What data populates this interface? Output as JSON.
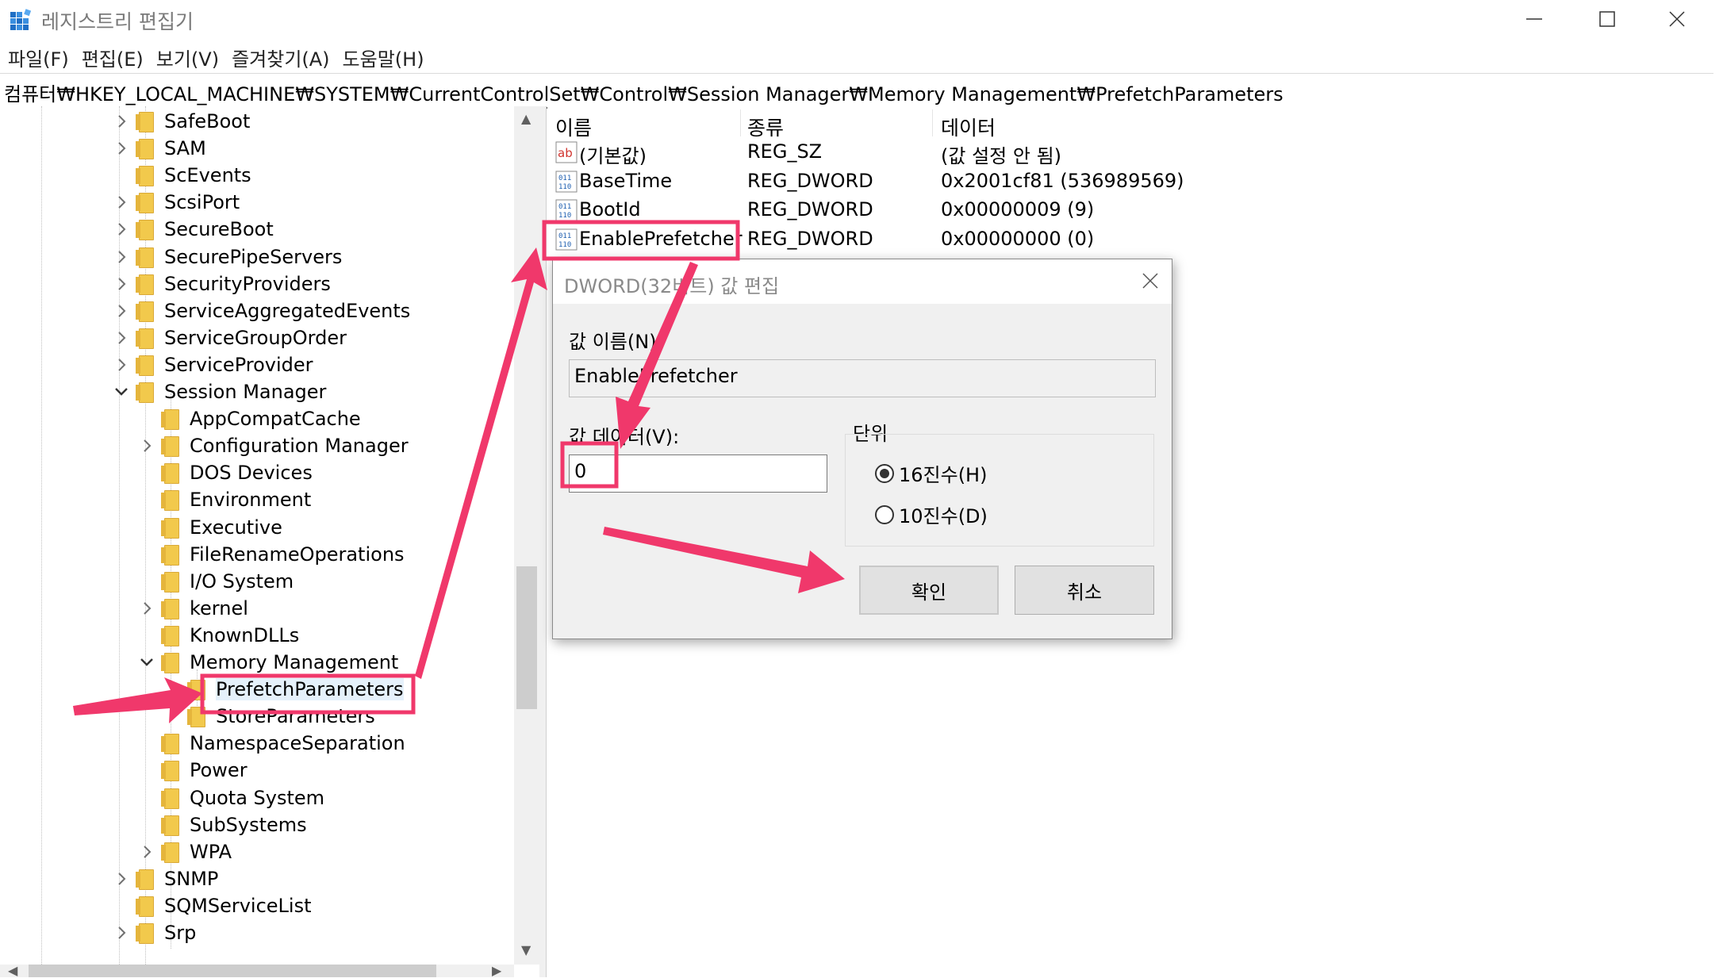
{
  "window": {
    "title": "레지스트리 편집기"
  },
  "menu": [
    "파일(F)",
    "편집(E)",
    "보기(V)",
    "즐겨찾기(A)",
    "도움말(H)"
  ],
  "address": "컴퓨터₩HKEY_LOCAL_MACHINE₩SYSTEM₩CurrentControlSet₩Control₩Session Manager₩Memory Management₩PrefetchParameters",
  "tree": [
    {
      "label": "SafeBoot",
      "expander": "right"
    },
    {
      "label": "SAM",
      "expander": "right"
    },
    {
      "label": "ScEvents",
      "expander": "none"
    },
    {
      "label": "ScsiPort",
      "expander": "right"
    },
    {
      "label": "SecureBoot",
      "expander": "right"
    },
    {
      "label": "SecurePipeServers",
      "expander": "right"
    },
    {
      "label": "SecurityProviders",
      "expander": "right"
    },
    {
      "label": "ServiceAggregatedEvents",
      "expander": "right"
    },
    {
      "label": "ServiceGroupOrder",
      "expander": "right"
    },
    {
      "label": "ServiceProvider",
      "expander": "right"
    },
    {
      "label": "Session Manager",
      "expander": "down"
    },
    {
      "label": "AppCompatCache",
      "expander": "none"
    },
    {
      "label": "Configuration Manager",
      "expander": "right"
    },
    {
      "label": "DOS Devices",
      "expander": "none"
    },
    {
      "label": "Environment",
      "expander": "none"
    },
    {
      "label": "Executive",
      "expander": "none"
    },
    {
      "label": "FileRenameOperations",
      "expander": "none"
    },
    {
      "label": "I/O System",
      "expander": "none"
    },
    {
      "label": "kernel",
      "expander": "right"
    },
    {
      "label": "KnownDLLs",
      "expander": "none"
    },
    {
      "label": "Memory Management",
      "expander": "down"
    },
    {
      "label": "PrefetchParameters",
      "expander": "none"
    },
    {
      "label": "StoreParameters",
      "expander": "none"
    },
    {
      "label": "NamespaceSeparation",
      "expander": "none"
    },
    {
      "label": "Power",
      "expander": "none"
    },
    {
      "label": "Quota System",
      "expander": "none"
    },
    {
      "label": "SubSystems",
      "expander": "none"
    },
    {
      "label": "WPA",
      "expander": "right"
    },
    {
      "label": "SNMP",
      "expander": "right"
    },
    {
      "label": "SQMServiceList",
      "expander": "none"
    },
    {
      "label": "Srp",
      "expander": "right"
    }
  ],
  "list": {
    "headers": {
      "name": "이름",
      "type": "종류",
      "data": "데이터"
    },
    "rows": [
      {
        "icon": "string-value-icon",
        "name": "(기본값)",
        "type": "REG_SZ",
        "data": "(값 설정 안 됨)"
      },
      {
        "icon": "binary-value-icon",
        "name": "BaseTime",
        "type": "REG_DWORD",
        "data": "0x2001cf81 (536989569)"
      },
      {
        "icon": "binary-value-icon",
        "name": "BootId",
        "type": "REG_DWORD",
        "data": "0x00000009 (9)"
      },
      {
        "icon": "binary-value-icon",
        "name": "EnablePrefetcher",
        "type": "REG_DWORD",
        "data": "0x00000000 (0)"
      }
    ]
  },
  "dialog": {
    "title": "DWORD(32비트) 값 편집",
    "name_label": "값 이름(N):",
    "name_value": "EnablePrefetcher",
    "data_label": "값 데이터(V):",
    "data_value": "0",
    "base_label": "단위",
    "hex_label": "16진수(H)",
    "dec_label": "10진수(D)",
    "ok": "확인",
    "cancel": "취소"
  },
  "colors": {
    "annotation": "#f0386b",
    "folder": "#f2c94c"
  }
}
